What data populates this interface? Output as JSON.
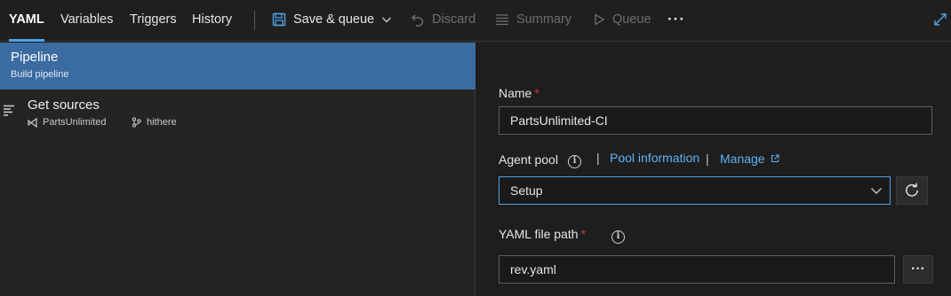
{
  "tabs": [
    {
      "label": "YAML",
      "active": true
    },
    {
      "label": "Variables"
    },
    {
      "label": "Triggers"
    },
    {
      "label": "History"
    }
  ],
  "toolbar": {
    "save_queue": "Save & queue",
    "discard": "Discard",
    "summary": "Summary",
    "queue": "Queue",
    "more": "···"
  },
  "tree": {
    "pipeline_title": "Pipeline",
    "pipeline_subtitle": "Build pipeline",
    "sources_title": "Get sources",
    "repo": "PartsUnlimited",
    "branch": "hithere"
  },
  "form": {
    "name_label": "Name",
    "name_value": "PartsUnlimited-CI",
    "agent_pool_label": "Agent pool",
    "pool_information_link": "Pool information",
    "manage_link": "Manage",
    "agent_pool_value": "Setup",
    "yaml_path_label": "YAML file path",
    "yaml_path_value": "rev.yaml",
    "required_mark": "*",
    "link_separator": "|"
  },
  "colors": {
    "accent": "#4fa3e8",
    "selected_row": "#3a6ba1",
    "link": "#5fb2f5",
    "required": "#d13438"
  }
}
